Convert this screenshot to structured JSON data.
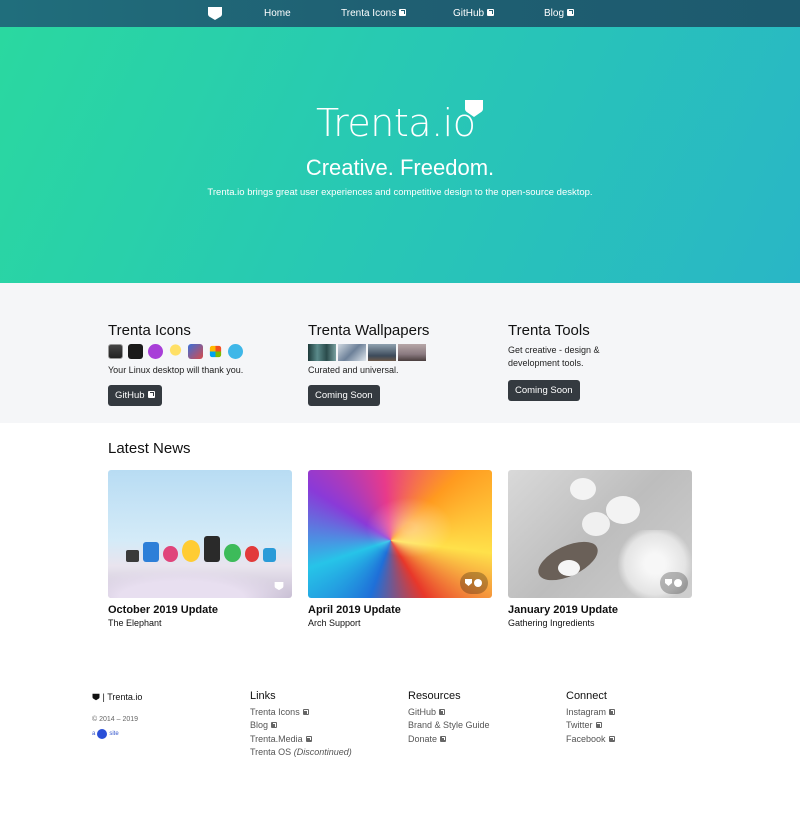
{
  "nav": {
    "home": "Home",
    "icons": "Trenta Icons",
    "github": "GitHub",
    "blog": "Blog"
  },
  "hero": {
    "brand": "Trenta.io",
    "tagline": "Creative. Freedom.",
    "subline": "Trenta.io brings great user experiences and competitive design to the open-source desktop."
  },
  "products": [
    {
      "title": "Trenta Icons",
      "desc": "Your Linux desktop will thank you.",
      "button": "GitHub"
    },
    {
      "title": "Trenta Wallpapers",
      "desc": "Curated and universal.",
      "button": "Coming Soon"
    },
    {
      "title": "Trenta Tools",
      "desc": "Get creative - design & development tools.",
      "button": "Coming Soon"
    }
  ],
  "news": {
    "title": "Latest News",
    "cards": [
      {
        "title": "October 2019 Update",
        "sub": "The Elephant"
      },
      {
        "title": "April 2019 Update",
        "sub": "Arch Support"
      },
      {
        "title": "January 2019 Update",
        "sub": "Gathering Ingredients"
      }
    ]
  },
  "footer": {
    "brand": "| Trenta.io",
    "copyright": "© 2014 – 2019",
    "site_prefix": "a",
    "site_suffix": "site",
    "links": {
      "heading": "Links",
      "items": [
        "Trenta Icons",
        "Blog",
        "Trenta.Media",
        "Trenta OS"
      ],
      "discontinued": "(Discontinued)"
    },
    "resources": {
      "heading": "Resources",
      "items": [
        "GitHub",
        "Brand & Style Guide",
        "Donate"
      ]
    },
    "connect": {
      "heading": "Connect",
      "items": [
        "Instagram",
        "Twitter",
        "Facebook"
      ]
    }
  },
  "colors": {
    "nav": "#1f5f72",
    "hero_start": "#2ad8a0",
    "hero_end": "#29b6c6",
    "button": "#343a40"
  }
}
